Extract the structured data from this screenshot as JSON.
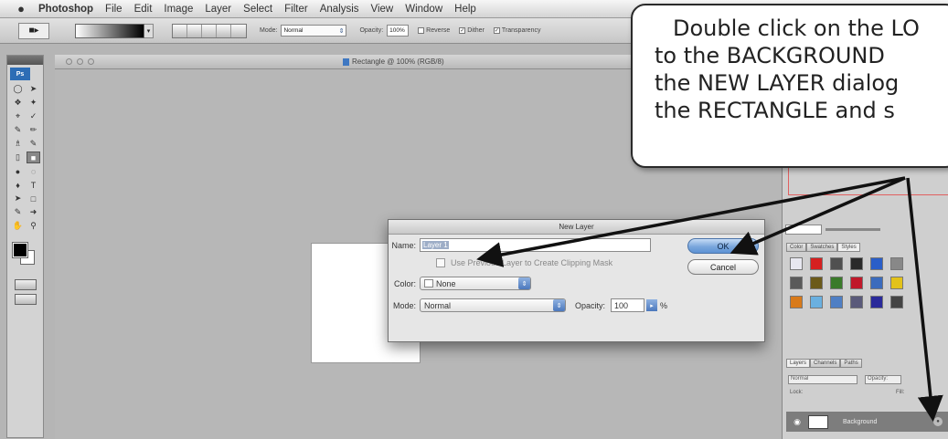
{
  "menubar": {
    "apple": "",
    "app": "Photoshop",
    "items": [
      "File",
      "Edit",
      "Image",
      "Layer",
      "Select",
      "Filter",
      "Analysis",
      "View",
      "Window",
      "Help"
    ]
  },
  "options_bar": {
    "mode_label": "Mode:",
    "mode_value": "Normal",
    "opacity_label": "Opacity:",
    "opacity_value": "100%",
    "reverse_label": "Reverse",
    "dither_label": "Dither",
    "transparency_label": "Transparency"
  },
  "tools": {
    "logo": "Ps"
  },
  "document": {
    "title": "Rectangle @ 100% (RGB/8)"
  },
  "right_panels": {
    "color_tabs": [
      "Color",
      "Swatches",
      "Styles"
    ],
    "layers_tabs": [
      "Layers",
      "Channels",
      "Paths"
    ],
    "blend_mode": "Normal",
    "opacity_label": "Opacity:",
    "lock_label": "Lock:",
    "fill_label": "Fill:",
    "background_layer_name": "Background",
    "style_colors": [
      "#e8e8f0",
      "#d62020",
      "#505050",
      "#2a2a2a",
      "#2a5ec8",
      "#888888",
      "#5a5a5a",
      "#6b5a1a",
      "#3a7a2a",
      "#c0182a",
      "#3b6bbd",
      "#e3c21a",
      "#d87a1a",
      "#6ab0e0",
      "#4f7fc4",
      "#5a5a7a",
      "#2a2a9a",
      "#444444"
    ]
  },
  "dialog": {
    "title": "New Layer",
    "name_label": "Name:",
    "name_value": "Layer 1",
    "clip_label": "Use Previous Layer to Create Clipping Mask",
    "color_label": "Color:",
    "color_value": "None",
    "mode_label": "Mode:",
    "mode_value": "Normal",
    "opacity_label": "Opacity:",
    "opacity_value": "100",
    "percent": "%",
    "ok_label": "OK",
    "cancel_label": "Cancel"
  },
  "callout": {
    "lines": [
      "Double click on the LO",
      "to the BACKGROUND",
      "the NEW LAYER dialog",
      "the RECTANGLE and s"
    ]
  }
}
